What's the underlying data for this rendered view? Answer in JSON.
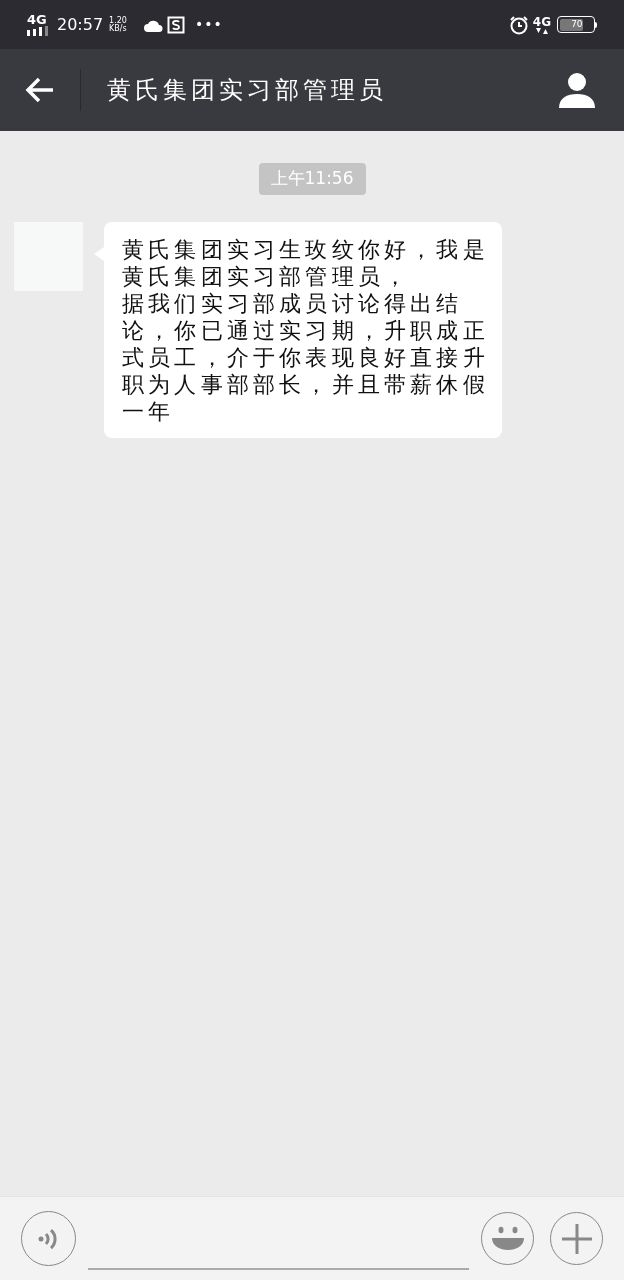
{
  "status_bar": {
    "network": "4G",
    "time": "20:57",
    "speed_value": "1.20",
    "speed_unit": "KB/s",
    "more": "•••",
    "network_right": "4G",
    "battery": "70"
  },
  "header": {
    "title": "黄氏集团实习部管理员"
  },
  "messages": [
    {
      "kind": "timestamp",
      "text": "上午11:56"
    },
    {
      "kind": "incoming",
      "paragraphs": [
        "黄氏集团实习生玫纹你好，我是黄氏集团实习部管理员，",
        "据我们实习部成员讨论得出结论，你已通过实习期，升职成正式员工，介于你表现良好直接升职为人事部部长，并且带薪休假一年"
      ]
    }
  ]
}
